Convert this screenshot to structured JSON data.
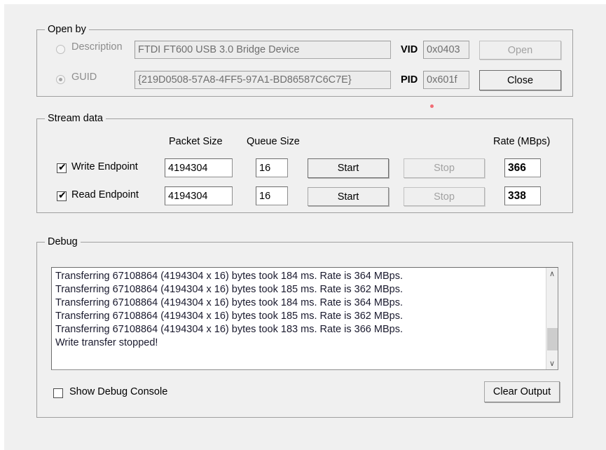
{
  "window": {
    "background": "#f0f0f0"
  },
  "open_by": {
    "title": "Open by",
    "description_radio_label": "Description",
    "guid_radio_label": "GUID",
    "description_value": "FTDI FT600 USB 3.0 Bridge Device",
    "guid_value": "{219D0508-57A8-4FF5-97A1-BD86587C6C7E}",
    "vid_label": "VID",
    "vid_value": "0x0403",
    "pid_label": "PID",
    "pid_value": "0x601f",
    "open_button": "Open",
    "close_button": "Close"
  },
  "stream_data": {
    "title": "Stream data",
    "packet_size_header": "Packet Size",
    "queue_size_header": "Queue Size",
    "rate_header": "Rate (MBps)",
    "rows": [
      {
        "endpoint_label": "Write Endpoint",
        "checked": true,
        "packet_size": "4194304",
        "queue_size": "16",
        "start_button": "Start",
        "stop_button": "Stop",
        "rate": "366"
      },
      {
        "endpoint_label": "Read Endpoint",
        "checked": true,
        "packet_size": "4194304",
        "queue_size": "16",
        "start_button": "Start",
        "stop_button": "Stop",
        "rate": "338"
      }
    ]
  },
  "debug": {
    "title": "Debug",
    "lines": [
      "Transferring 67108864 (4194304 x 16) bytes took 184 ms. Rate is 364 MBps.",
      "Transferring 67108864 (4194304 x 16) bytes took 185 ms. Rate is 362 MBps.",
      "Transferring 67108864 (4194304 x 16) bytes took 184 ms. Rate is 364 MBps.",
      "Transferring 67108864 (4194304 x 16) bytes took 185 ms. Rate is 362 MBps.",
      "Transferring 67108864 (4194304 x 16) bytes took 183 ms. Rate is 366 MBps.",
      "Write transfer stopped!"
    ],
    "scroll_up_icon": "∧",
    "scroll_down_icon": "∨",
    "show_debug_console_label": "Show Debug Console",
    "show_debug_console_checked": false,
    "clear_output_button": "Clear Output"
  },
  "icons": {
    "check_glyph": "✔"
  }
}
